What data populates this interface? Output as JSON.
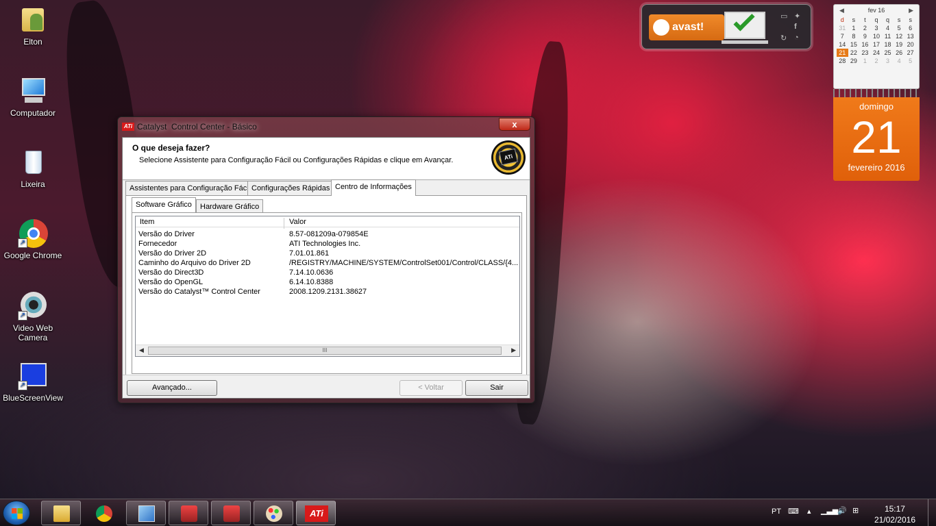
{
  "desktop": {
    "icons": [
      {
        "label": "Elton"
      },
      {
        "label": "Computador"
      },
      {
        "label": "Lixeira"
      },
      {
        "label": "Google Chrome"
      },
      {
        "label": "Video Web\nCamera"
      },
      {
        "label": "BlueScreenView"
      }
    ]
  },
  "avast": {
    "logo_text": "avast!"
  },
  "calendar": {
    "month_label": "fev 16",
    "weekday_headers": [
      "d",
      "s",
      "t",
      "q",
      "q",
      "s",
      "s"
    ],
    "weeks": [
      [
        "31",
        "1",
        "2",
        "3",
        "4",
        "5",
        "6"
      ],
      [
        "7",
        "8",
        "9",
        "10",
        "11",
        "12",
        "13"
      ],
      [
        "14",
        "15",
        "16",
        "17",
        "18",
        "19",
        "20"
      ],
      [
        "21",
        "22",
        "23",
        "24",
        "25",
        "26",
        "27"
      ],
      [
        "28",
        "29",
        "1",
        "2",
        "3",
        "4",
        "5"
      ]
    ],
    "weekday": "domingo",
    "day": "21",
    "month_year": "fevereiro 2016"
  },
  "window": {
    "title_prefix": "Catalyst",
    "title_rest": "Control Center - Básico",
    "close_glyph": "x",
    "logo_text": "ATi",
    "header_title": "O que deseja fazer?",
    "header_sub": "Selecione Assistente para Configuração Fácil ou Configurações Rápidas e clique em Avançar.",
    "tabs": [
      "Assistentes para Configuração Fácil",
      "Configurações Rápidas",
      "Centro de Informações"
    ],
    "subtabs": [
      "Software Gráfico",
      "Hardware Gráfico"
    ],
    "columns": [
      "Item",
      "Valor"
    ],
    "rows": [
      {
        "item": "Versão do Driver",
        "value": "8.57-081209a-079854E"
      },
      {
        "item": "Fornecedor",
        "value": "ATI Technologies Inc."
      },
      {
        "item": "Versão do Driver 2D",
        "value": "7.01.01.861"
      },
      {
        "item": "Caminho do Arquivo do Driver 2D",
        "value": "/REGISTRY/MACHINE/SYSTEM/ControlSet001/Control/CLASS/{4..."
      },
      {
        "item": "Versão do Direct3D",
        "value": "7.14.10.0636"
      },
      {
        "item": "Versão do OpenGL",
        "value": "6.14.10.8388"
      },
      {
        "item": "Versão do Catalyst™ Control Center",
        "value": "2008.1209.2131.38627"
      }
    ],
    "scroll_grip": "III",
    "buttons": {
      "advanced": "Avançado...",
      "back": "< Voltar",
      "exit": "Sair"
    }
  },
  "taskbar": {
    "ati_label": "ATi",
    "tray_lang": "PT",
    "time": "15:17",
    "date": "21/02/2016"
  }
}
